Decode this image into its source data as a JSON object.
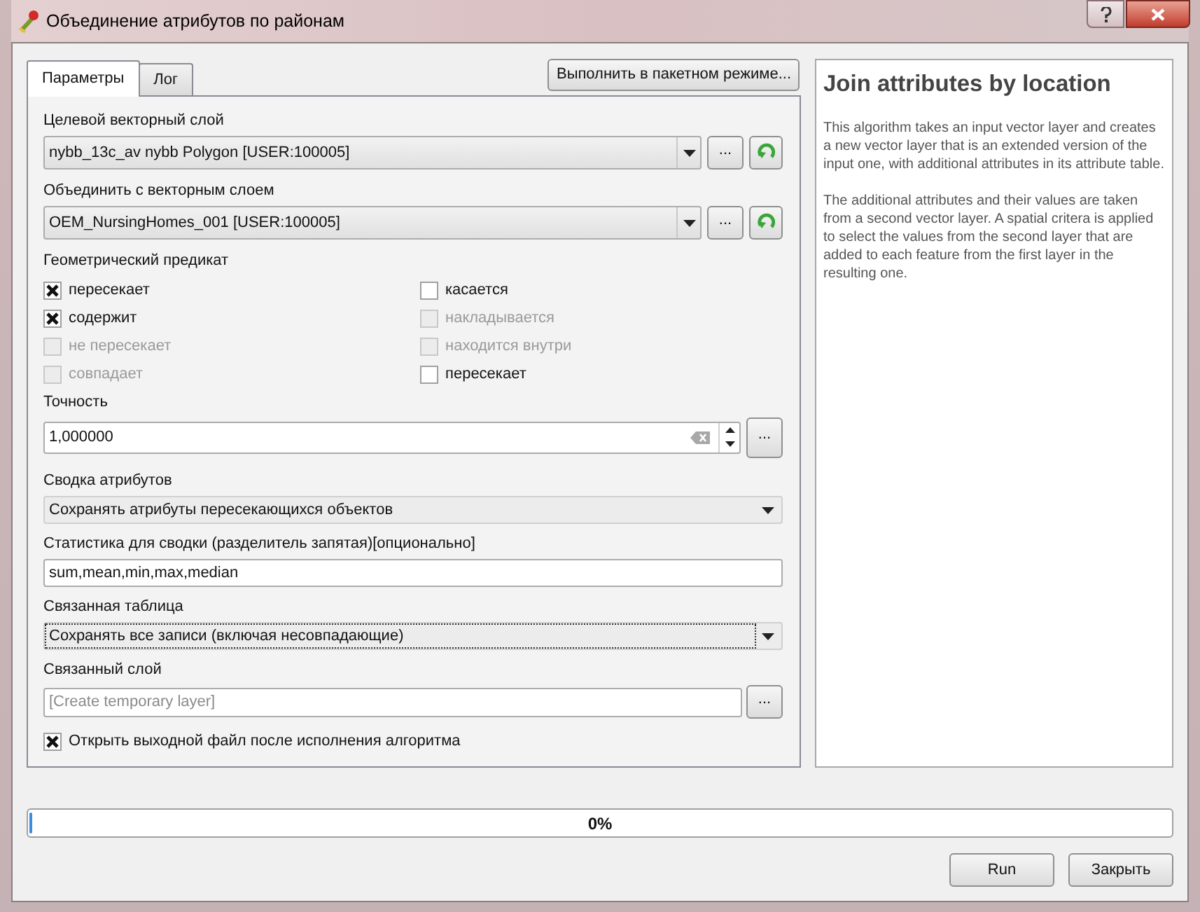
{
  "window": {
    "title": "Объединение атрибутов по районам"
  },
  "tabs": [
    {
      "label": "Параметры",
      "selected": true
    },
    {
      "label": "Лог",
      "selected": false
    }
  ],
  "batch_button": "Выполнить в пакетном режиме...",
  "fields": [
    {
      "kind": "combo",
      "label": "Целевой векторный слой",
      "value": "nybb_13c_av nybb Polygon [USER:100005]",
      "browse": "...",
      "focused": false
    },
    {
      "kind": "combo",
      "label": "Объединить с векторным слоем",
      "value": "OEM_NursingHomes_001 [USER:100005]",
      "browse": "...",
      "focused": false
    },
    {
      "kind": "checks",
      "label": "Геометрический предикат",
      "options": [
        {
          "label": "пересекает",
          "checked": true,
          "disabled": false
        },
        {
          "label": "касается",
          "checked": false,
          "disabled": false
        },
        {
          "label": "содержит",
          "checked": true,
          "disabled": false
        },
        {
          "label": "накладывается",
          "checked": false,
          "disabled": true
        },
        {
          "label": "не пересекает",
          "checked": false,
          "disabled": true
        },
        {
          "label": "находится внутри",
          "checked": false,
          "disabled": true
        },
        {
          "label": "совпадает",
          "checked": false,
          "disabled": true
        },
        {
          "label": "пересекает",
          "checked": false,
          "disabled": false
        }
      ]
    },
    {
      "kind": "spin",
      "label": "Точность",
      "value": "1,000000",
      "browse": "..."
    },
    {
      "kind": "select",
      "label": "Сводка атрибутов",
      "value": "Сохранять атрибуты пересекающихся объектов",
      "focused": false
    },
    {
      "kind": "text",
      "label": "Статистика для сводки (разделитель запятая)[опционально]",
      "value": "sum,mean,min,max,median"
    },
    {
      "kind": "select",
      "label": "Связанная таблица",
      "value": "Сохранять все записи (включая несовпадающие)",
      "focused": true
    },
    {
      "kind": "file",
      "label": "Связанный слой",
      "placeholder": "[Create temporary layer]",
      "browse": "..."
    }
  ],
  "open_output": {
    "label": "Открыть выходной файл после исполнения алгоритма",
    "checked": true
  },
  "help": {
    "title": "Join attributes by location",
    "paragraphs": [
      "This algorithm takes an input vector layer and creates a new vector layer that is an extended version of the input one, with additional attributes in its attribute table.",
      "The additional attributes and their values are taken from a second vector layer. A spatial critera is applied to select the values from the second layer that are added to each feature from the first layer in the resulting one."
    ]
  },
  "progress": {
    "level": 0,
    "reading": "0%"
  },
  "buttons": [
    "Run",
    "Закрыть"
  ]
}
